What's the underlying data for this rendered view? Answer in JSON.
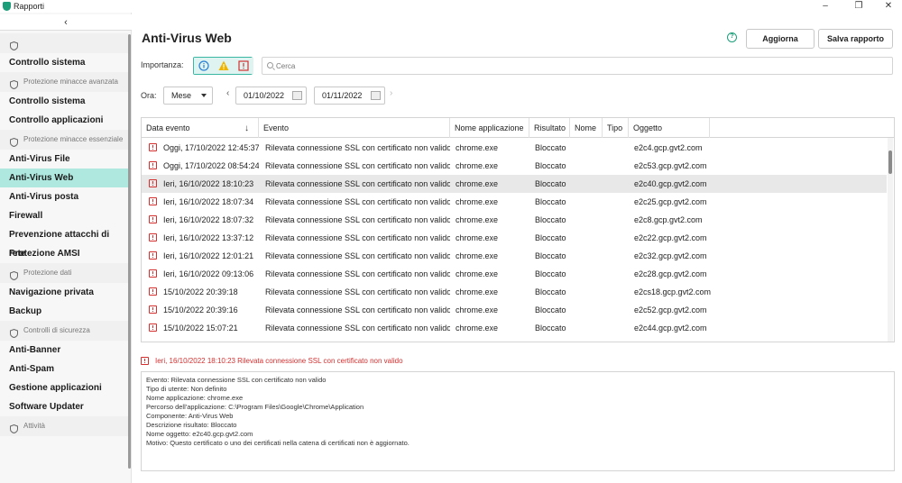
{
  "window": {
    "title": "Rapporti",
    "minimize": "–",
    "maximize": "❐",
    "close": "✕"
  },
  "sidebar": {
    "collapse_icon": "‹",
    "items": [
      {
        "kind": "group",
        "label": "",
        "icon": "shield-icon"
      },
      {
        "kind": "item",
        "label": "Controllo sistema"
      },
      {
        "kind": "group",
        "label": "Protezione minacce avanzata",
        "icon": "shield-icon"
      },
      {
        "kind": "item",
        "label": "Controllo sistema"
      },
      {
        "kind": "item",
        "label": "Controllo applicazioni"
      },
      {
        "kind": "group",
        "label": "Protezione minacce essenziale",
        "icon": "shield-icon"
      },
      {
        "kind": "item",
        "label": "Anti-Virus File"
      },
      {
        "kind": "item",
        "label": "Anti-Virus Web",
        "active": true
      },
      {
        "kind": "item",
        "label": "Anti-Virus posta"
      },
      {
        "kind": "item",
        "label": "Firewall"
      },
      {
        "kind": "item",
        "label": "Prevenzione attacchi di rete"
      },
      {
        "kind": "item",
        "label": "Protezione AMSI"
      },
      {
        "kind": "group",
        "label": "Protezione dati",
        "icon": "lock-icon"
      },
      {
        "kind": "item",
        "label": "Navigazione privata"
      },
      {
        "kind": "item",
        "label": "Backup"
      },
      {
        "kind": "group",
        "label": "Controlli di sicurezza",
        "icon": "gear-icon"
      },
      {
        "kind": "item",
        "label": "Anti-Banner"
      },
      {
        "kind": "item",
        "label": "Anti-Spam"
      },
      {
        "kind": "item",
        "label": "Gestione applicazioni"
      },
      {
        "kind": "item",
        "label": "Software Updater"
      },
      {
        "kind": "group",
        "label": "Attività",
        "icon": "checklist-icon"
      }
    ]
  },
  "header": {
    "title": "Anti-Virus Web",
    "help_icon": "?",
    "refresh_label": "Aggiorna",
    "save_label": "Salva rapporto"
  },
  "filters": {
    "importance_label": "Importanza:",
    "importance_levels": [
      {
        "name": "info",
        "selected": true
      },
      {
        "name": "warning",
        "selected": true
      },
      {
        "name": "critical",
        "selected": true
      }
    ],
    "search_placeholder": "Cerca",
    "time_label": "Ora:",
    "period": "Mese",
    "date_from": "01/10/2022",
    "date_to": "01/11/2022",
    "prev": "‹",
    "next": "›"
  },
  "table": {
    "columns": [
      "Data evento",
      "Evento",
      "Nome applicazione",
      "Risultato",
      "Nome",
      "Tipo",
      "Oggetto"
    ],
    "sort_indicator": "↓",
    "rows": [
      {
        "date": "Oggi, 17/10/2022 12:45:37",
        "event": "Rilevata connessione SSL con certificato non valido",
        "app": "chrome.exe",
        "result": "Bloccato",
        "name": "",
        "type": "",
        "object": "e2c4.gcp.gvt2.com"
      },
      {
        "date": "Oggi, 17/10/2022 08:54:24",
        "event": "Rilevata connessione SSL con certificato non valido",
        "app": "chrome.exe",
        "result": "Bloccato",
        "name": "",
        "type": "",
        "object": "e2c53.gcp.gvt2.com"
      },
      {
        "date": "Ieri, 16/10/2022 18:10:23",
        "event": "Rilevata connessione SSL con certificato non valido",
        "app": "chrome.exe",
        "result": "Bloccato",
        "name": "",
        "type": "",
        "object": "e2c40.gcp.gvt2.com",
        "selected": true
      },
      {
        "date": "Ieri, 16/10/2022 18:07:34",
        "event": "Rilevata connessione SSL con certificato non valido",
        "app": "chrome.exe",
        "result": "Bloccato",
        "name": "",
        "type": "",
        "object": "e2c25.gcp.gvt2.com"
      },
      {
        "date": "Ieri, 16/10/2022 18:07:32",
        "event": "Rilevata connessione SSL con certificato non valido",
        "app": "chrome.exe",
        "result": "Bloccato",
        "name": "",
        "type": "",
        "object": "e2c8.gcp.gvt2.com"
      },
      {
        "date": "Ieri, 16/10/2022 13:37:12",
        "event": "Rilevata connessione SSL con certificato non valido",
        "app": "chrome.exe",
        "result": "Bloccato",
        "name": "",
        "type": "",
        "object": "e2c22.gcp.gvt2.com"
      },
      {
        "date": "Ieri, 16/10/2022 12:01:21",
        "event": "Rilevata connessione SSL con certificato non valido",
        "app": "chrome.exe",
        "result": "Bloccato",
        "name": "",
        "type": "",
        "object": "e2c32.gcp.gvt2.com"
      },
      {
        "date": "Ieri, 16/10/2022 09:13:06",
        "event": "Rilevata connessione SSL con certificato non valido",
        "app": "chrome.exe",
        "result": "Bloccato",
        "name": "",
        "type": "",
        "object": "e2c28.gcp.gvt2.com"
      },
      {
        "date": "15/10/2022 20:39:18",
        "event": "Rilevata connessione SSL con certificato non valido",
        "app": "chrome.exe",
        "result": "Bloccato",
        "name": "",
        "type": "",
        "object": "e2cs18.gcp.gvt2.com"
      },
      {
        "date": "15/10/2022 20:39:16",
        "event": "Rilevata connessione SSL con certificato non valido",
        "app": "chrome.exe",
        "result": "Bloccato",
        "name": "",
        "type": "",
        "object": "e2c52.gcp.gvt2.com"
      },
      {
        "date": "15/10/2022 15:07:21",
        "event": "Rilevata connessione SSL con certificato non valido",
        "app": "chrome.exe",
        "result": "Bloccato",
        "name": "",
        "type": "",
        "object": "e2c44.gcp.gvt2.com"
      }
    ]
  },
  "details": {
    "header": "Ieri, 16/10/2022 18:10:23 Rilevata connessione SSL con certificato non valido",
    "lines": [
      "Evento: Rilevata connessione SSL con certificato non valido",
      "Tipo di utente: Non definito",
      "Nome applicazione: chrome.exe",
      "Percorso dell'applicazione: C:\\Program Files\\Google\\Chrome\\Application",
      "Componente: Anti-Virus Web",
      "Descrizione risultato: Bloccato",
      "Nome oggetto: e2c40.gcp.gvt2.com",
      "Motivo: Questo certificato o uno dei certificati nella catena di certificati non è aggiornato."
    ]
  },
  "colors": {
    "accent": "#1d9e7a",
    "active_bg": "#aee8df",
    "critical": "#d43030",
    "warning": "#f0b400",
    "info": "#2a7fd4"
  }
}
